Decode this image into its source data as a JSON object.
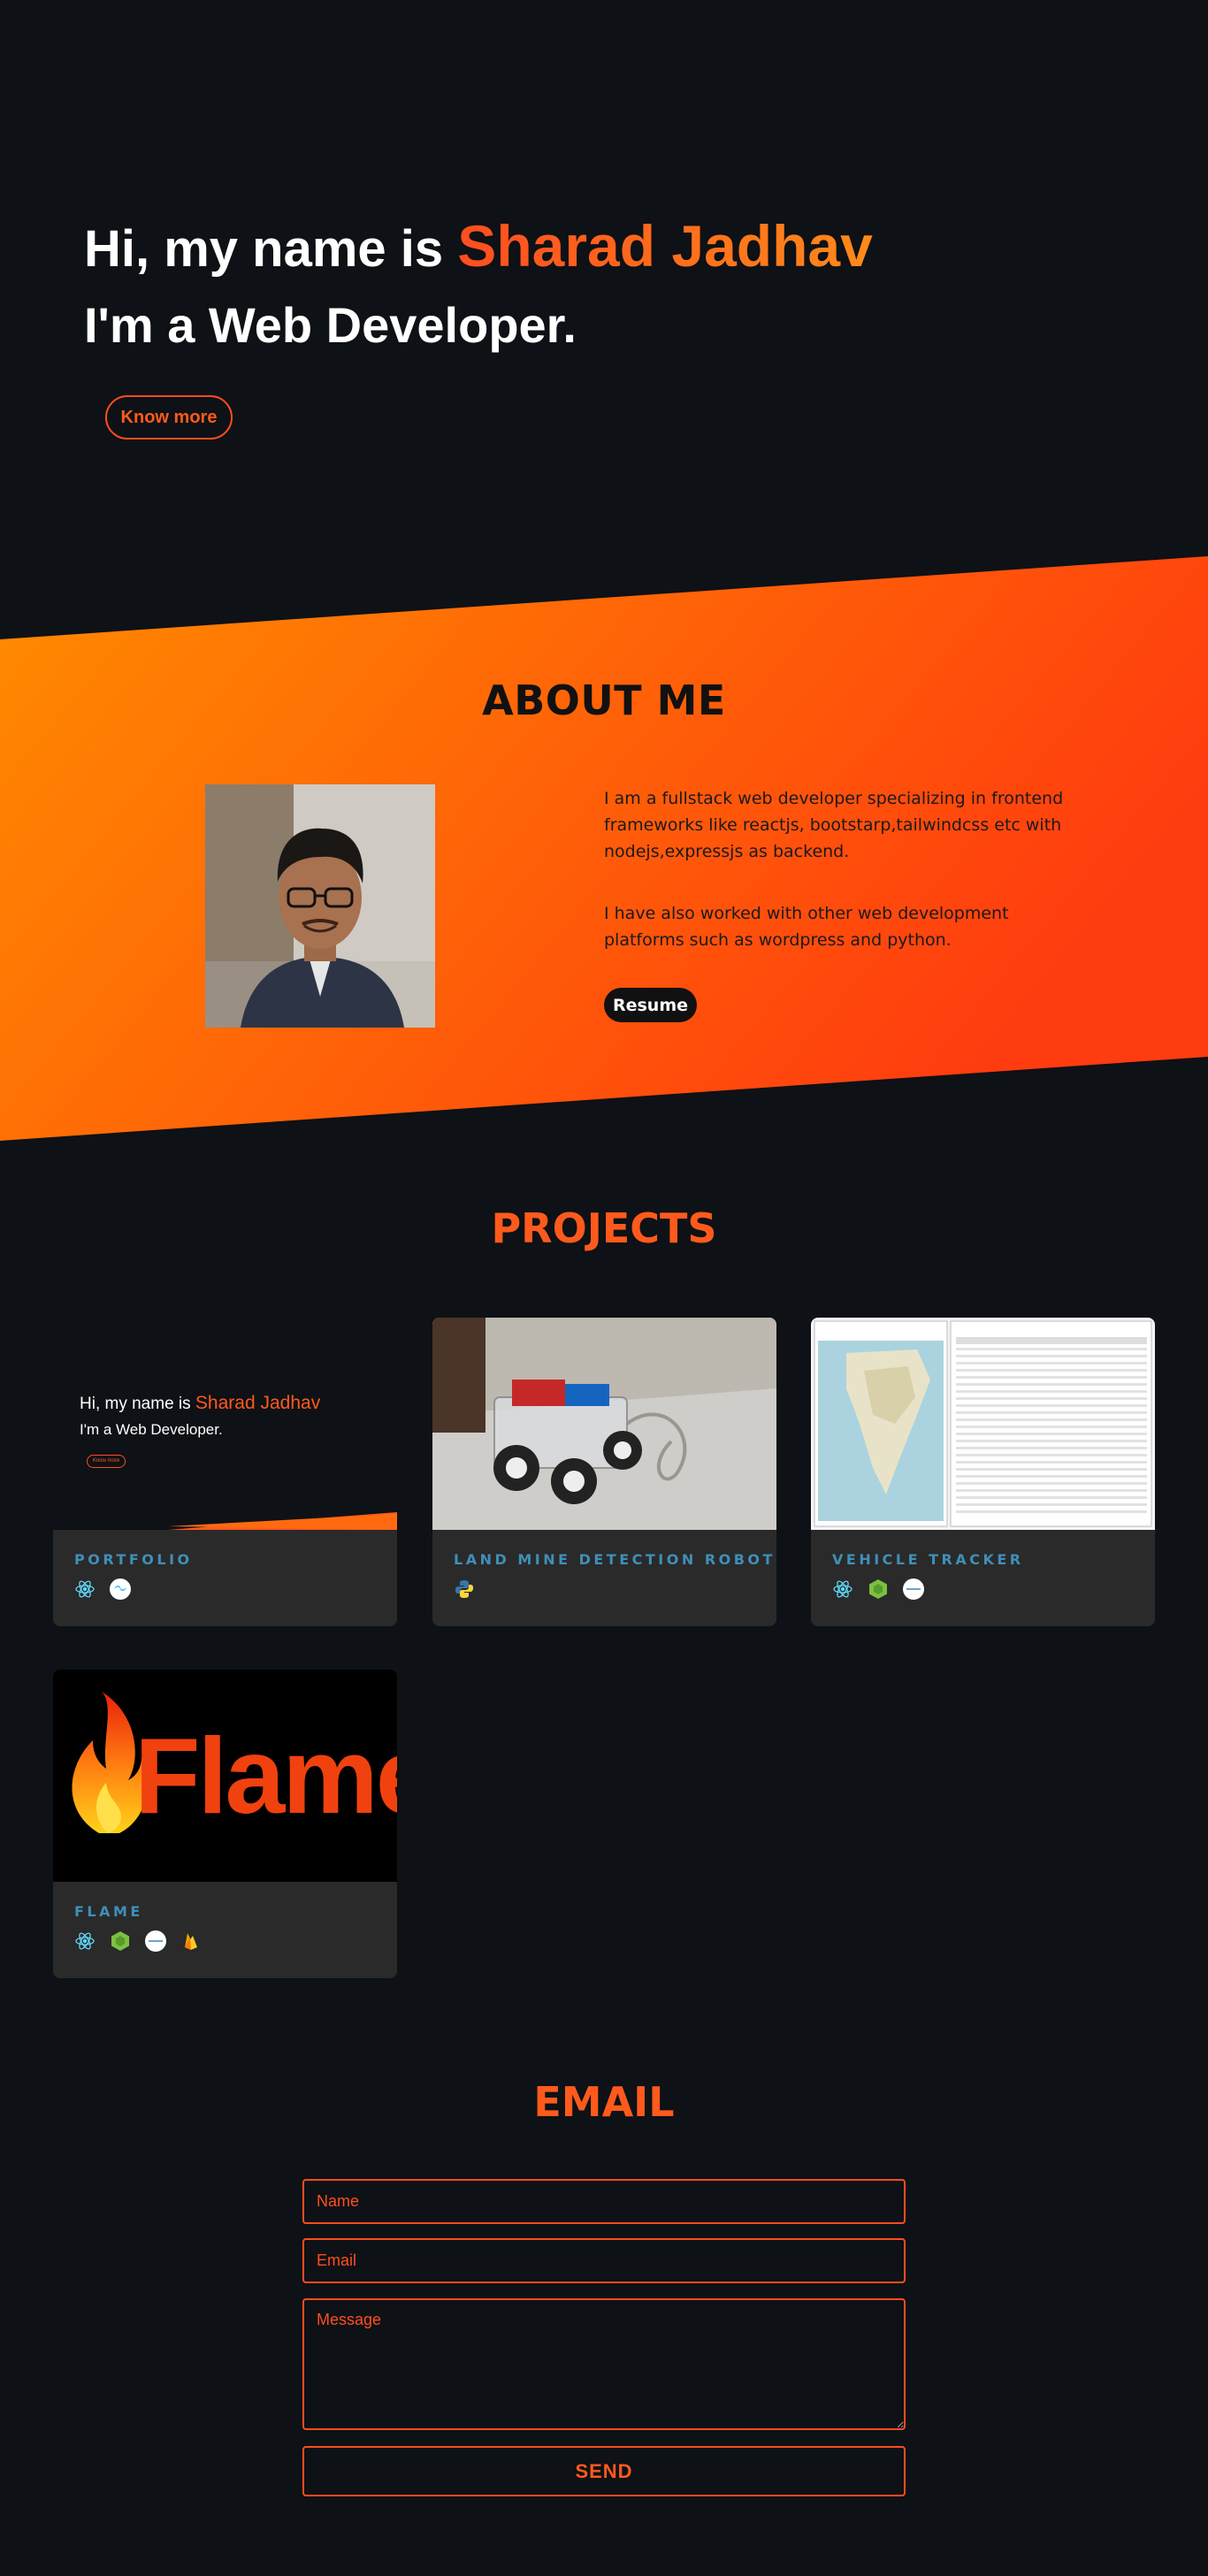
{
  "hero": {
    "greeting": "Hi, my name is ",
    "name": "Sharad Jadhav",
    "role": "I'm a Web Developer.",
    "cta_label": "Know more"
  },
  "about": {
    "title": "ABOUT ME",
    "paragraph1": "I am a fullstack web developer specializing in frontend frameworks like reactjs, bootstarp,tailwindcss etc with nodejs,expressjs as backend.",
    "paragraph2": "I have also worked with other web development platforms such as wordpress and python.",
    "resume_label": "Resume"
  },
  "projects": {
    "title": "PROJECTS",
    "items": [
      {
        "title": "PORTFOLIO",
        "icons": [
          "react-icon",
          "tailwind-icon"
        ],
        "preview": {
          "greeting": "Hi, my name is ",
          "name": "Sharad Jadhav",
          "role": "I'm a Web Developer.",
          "button": "Know more"
        }
      },
      {
        "title": "LAND MINE DETECTION ROBOT",
        "icons": [
          "python-icon"
        ]
      },
      {
        "title": "VEHICLE TRACKER",
        "icons": [
          "react-icon",
          "nodejs-icon",
          "express-icon"
        ]
      },
      {
        "title": "FLAME",
        "icons": [
          "react-icon",
          "nodejs-icon",
          "express-icon",
          "firebase-icon"
        ],
        "logo_text": "Flame"
      }
    ]
  },
  "contact": {
    "title": "EMAIL",
    "name_placeholder": "Name",
    "email_placeholder": "Email",
    "message_placeholder": "Message",
    "send_label": "SEND"
  },
  "colors": {
    "background": "#0e1115",
    "accent": "#ff5a1c",
    "gradient_start": "#ff8c00",
    "gradient_end": "#ff3c0f",
    "card": "#2a2a2a",
    "card_title": "#3f8fb8"
  }
}
